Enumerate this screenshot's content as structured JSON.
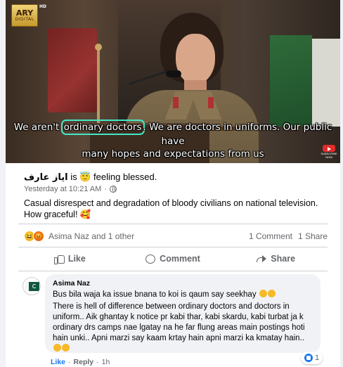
{
  "video": {
    "channel_logo_main": "ARY",
    "channel_logo_sub": "DIGITAL",
    "channel_logo_hd": "HD",
    "subtitle_before": "We aren't ",
    "subtitle_highlight": "ordinary doctors",
    "subtitle_after": ". We are doctors in uniforms. Our public have",
    "subtitle_line2": "many hopes and expectations from us",
    "yt_badge_text": "SUBSCRIBE NOW",
    "highlight_color": "#43e8c4"
  },
  "post": {
    "author": "ایاز عارف",
    "status_is": "is",
    "status_emoji": "😇",
    "status_text": "feeling blessed.",
    "timestamp": "Yesterday at 10:21 AM",
    "separator": "·",
    "text": "Casual disrespect and degradation of bloody civilians on national television. How graceful! 🥰"
  },
  "reactions": {
    "icons": [
      "😆",
      "😡"
    ],
    "text": "Asima Naz and 1 other",
    "comment_count": "1 Comment",
    "share_count": "1 Share"
  },
  "actions": {
    "like": "Like",
    "comment": "Comment",
    "share": "Share"
  },
  "comment": {
    "author": "Asima Naz",
    "line1": "Bus bila waja ka issue bnana to koi is qaum say seekhay",
    "line2": "There is hell of difference between ordinary doctors and doctors in uniform.. Aik ghantay k notice pr kabi thar, kabi skardu, kabi turbat ja k ordinary drs camps nae lgatay na he far flung areas main postings hoti hain unki.. Apni marzi say kaam krtay hain apni marzi ka kmatay hain..",
    "like_count": "1",
    "footer_like": "Like",
    "footer_reply": "Reply",
    "footer_sep": "·",
    "footer_time": "1h"
  },
  "colors": {
    "facebook_blue": "#1877f2",
    "secondary_text": "#65676b",
    "bubble_bg": "#f0f2f5"
  }
}
